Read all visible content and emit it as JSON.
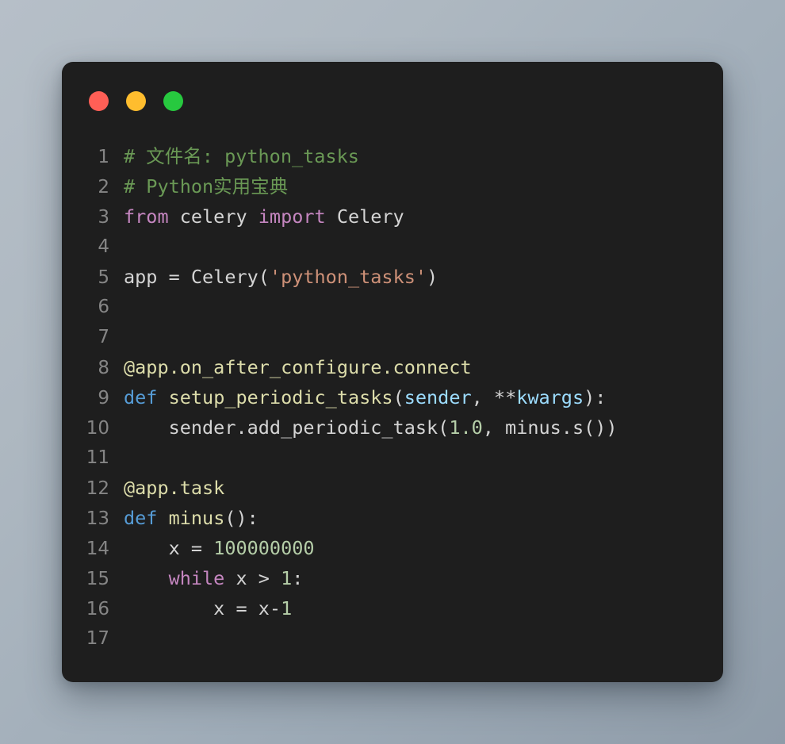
{
  "window": {
    "controls": [
      {
        "name": "close",
        "color": "#ff5f56"
      },
      {
        "name": "minimize",
        "color": "#ffbd2e"
      },
      {
        "name": "maximize",
        "color": "#27c93f"
      }
    ]
  },
  "theme": {
    "background_gradient_from": "#b6bfc8",
    "background_gradient_to": "#8f9ca9",
    "card_background": "#1e1e1e",
    "line_number_color": "#858585",
    "comment": "#6a9955",
    "keyword": "#c586c0",
    "def_keyword": "#569cd6",
    "function": "#dcdcaa",
    "string": "#ce9178",
    "number": "#b5cea8",
    "parameter": "#9cdcfe",
    "plain": "#d4d4d4"
  },
  "editor": {
    "language": "python",
    "line_numbers": [
      "1",
      "2",
      "3",
      "4",
      "5",
      "6",
      "7",
      "8",
      "9",
      "10",
      "11",
      "12",
      "13",
      "14",
      "15",
      "16",
      "17"
    ],
    "lines": [
      {
        "number": "1",
        "text": "# 文件名: python_tasks",
        "tokens": [
          {
            "t": "# 文件名: python_tasks",
            "c": "tok-comment"
          }
        ]
      },
      {
        "number": "2",
        "text": "# Python实用宝典",
        "tokens": [
          {
            "t": "# Python实用宝典",
            "c": "tok-comment"
          }
        ]
      },
      {
        "number": "3",
        "text": "from celery import Celery",
        "tokens": [
          {
            "t": "from",
            "c": "tok-keyword"
          },
          {
            "t": " celery ",
            "c": "tok-plain"
          },
          {
            "t": "import",
            "c": "tok-keyword"
          },
          {
            "t": " Celery",
            "c": "tok-plain"
          }
        ]
      },
      {
        "number": "4",
        "text": "",
        "tokens": []
      },
      {
        "number": "5",
        "text": "app = Celery('python_tasks')",
        "tokens": [
          {
            "t": "app = Celery(",
            "c": "tok-plain"
          },
          {
            "t": "'python_tasks'",
            "c": "tok-string"
          },
          {
            "t": ")",
            "c": "tok-plain"
          }
        ]
      },
      {
        "number": "6",
        "text": "",
        "tokens": []
      },
      {
        "number": "7",
        "text": "",
        "tokens": []
      },
      {
        "number": "8",
        "text": "@app.on_after_configure.connect",
        "tokens": [
          {
            "t": "@app.on_after_configure.connect",
            "c": "tok-deco"
          }
        ]
      },
      {
        "number": "9",
        "text": "def setup_periodic_tasks(sender, **kwargs):",
        "tokens": [
          {
            "t": "def",
            "c": "tok-def"
          },
          {
            "t": " ",
            "c": "tok-plain"
          },
          {
            "t": "setup_periodic_tasks",
            "c": "tok-func"
          },
          {
            "t": "(",
            "c": "tok-plain"
          },
          {
            "t": "sender",
            "c": "tok-param"
          },
          {
            "t": ", ",
            "c": "tok-plain"
          },
          {
            "t": "**",
            "c": "tok-op"
          },
          {
            "t": "kwargs",
            "c": "tok-param"
          },
          {
            "t": "):",
            "c": "tok-plain"
          }
        ]
      },
      {
        "number": "10",
        "text": "    sender.add_periodic_task(1.0, minus.s())",
        "tokens": [
          {
            "t": "    sender.add_periodic_task(",
            "c": "tok-plain"
          },
          {
            "t": "1.0",
            "c": "tok-number"
          },
          {
            "t": ", minus.s())",
            "c": "tok-plain"
          }
        ]
      },
      {
        "number": "11",
        "text": "",
        "tokens": []
      },
      {
        "number": "12",
        "text": "@app.task",
        "tokens": [
          {
            "t": "@app.task",
            "c": "tok-deco"
          }
        ]
      },
      {
        "number": "13",
        "text": "def minus():",
        "tokens": [
          {
            "t": "def",
            "c": "tok-def"
          },
          {
            "t": " ",
            "c": "tok-plain"
          },
          {
            "t": "minus",
            "c": "tok-func"
          },
          {
            "t": "():",
            "c": "tok-plain"
          }
        ]
      },
      {
        "number": "14",
        "text": "    x = 100000000",
        "tokens": [
          {
            "t": "    x = ",
            "c": "tok-plain"
          },
          {
            "t": "100000000",
            "c": "tok-number"
          }
        ]
      },
      {
        "number": "15",
        "text": "    while x > 1:",
        "tokens": [
          {
            "t": "    ",
            "c": "tok-plain"
          },
          {
            "t": "while",
            "c": "tok-keyword"
          },
          {
            "t": " x > ",
            "c": "tok-plain"
          },
          {
            "t": "1",
            "c": "tok-number"
          },
          {
            "t": ":",
            "c": "tok-plain"
          }
        ]
      },
      {
        "number": "16",
        "text": "        x = x-1",
        "tokens": [
          {
            "t": "        x = x-",
            "c": "tok-plain"
          },
          {
            "t": "1",
            "c": "tok-number"
          }
        ]
      },
      {
        "number": "17",
        "text": "",
        "tokens": []
      }
    ]
  }
}
